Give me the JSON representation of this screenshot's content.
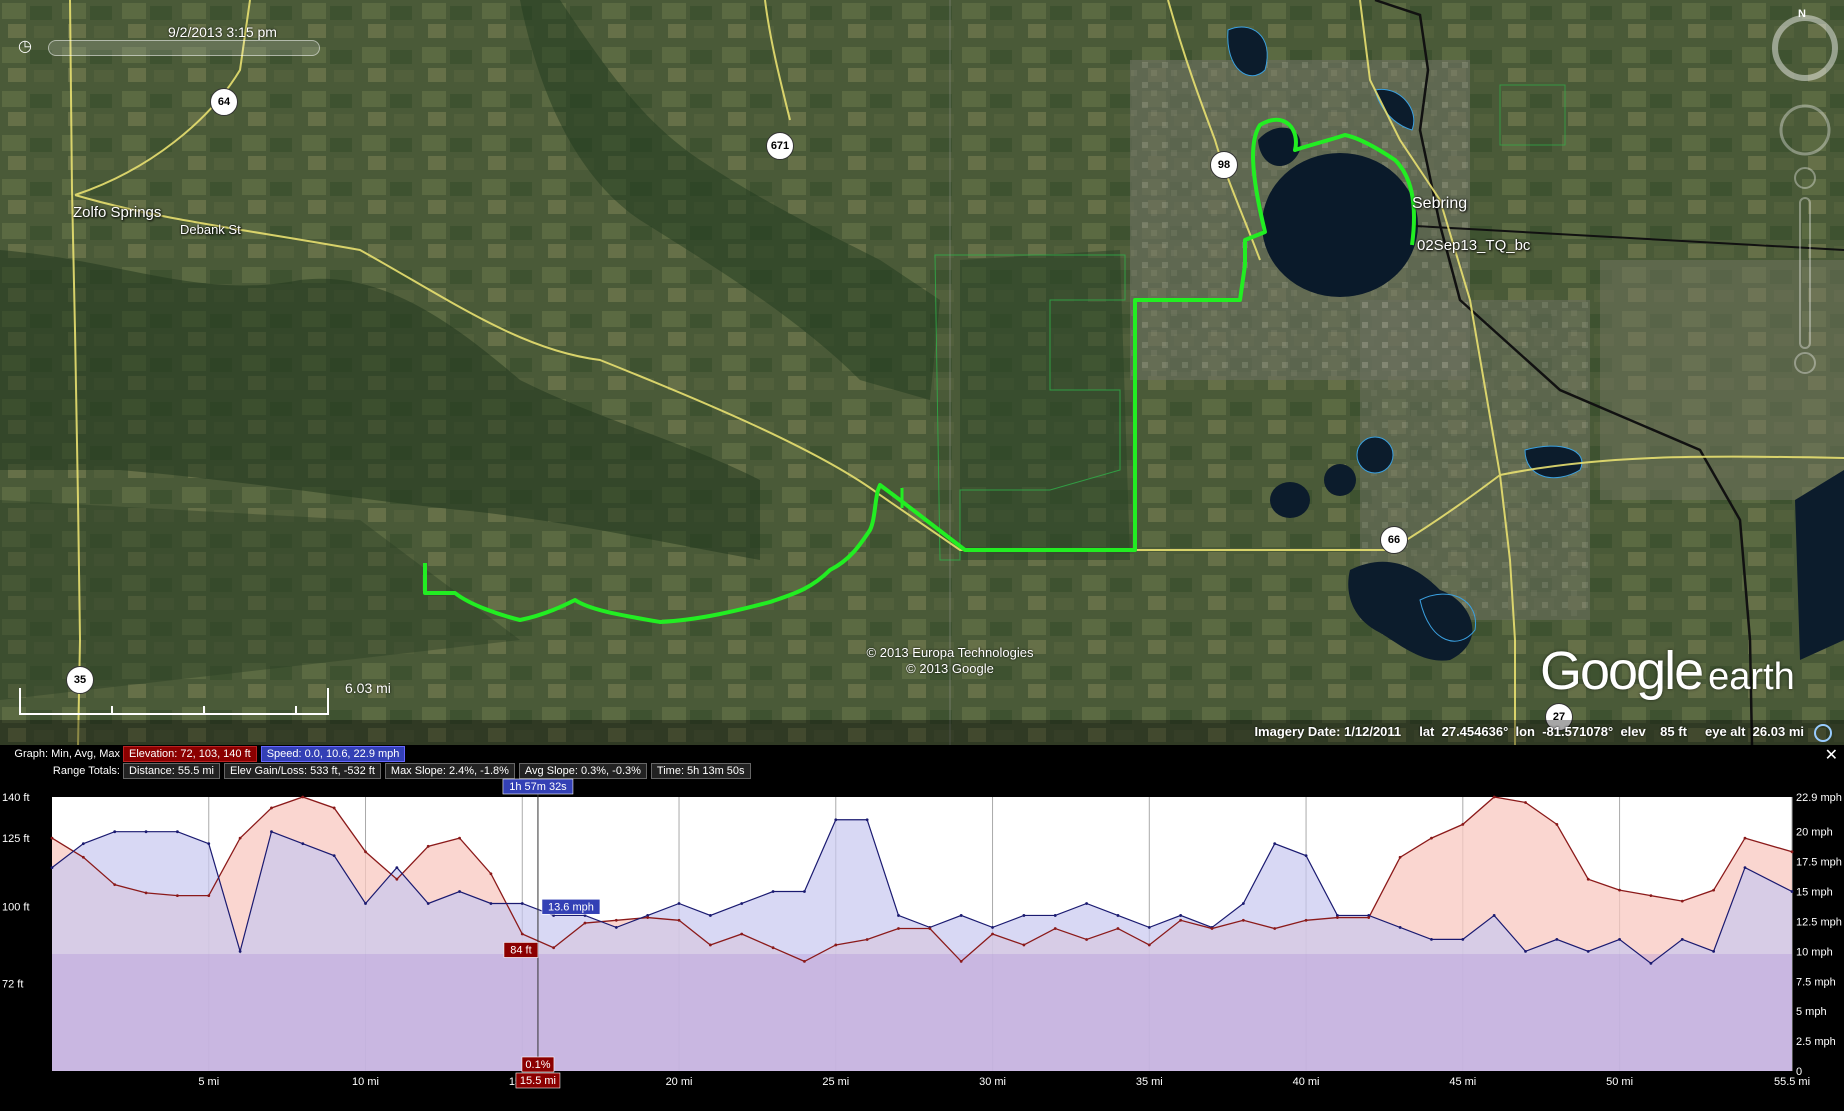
{
  "map": {
    "time_label": "9/2/2013   3:15 pm",
    "places": [
      {
        "name": "Zolfo Springs"
      },
      {
        "name": "Debank St"
      },
      {
        "name": "Sebring"
      },
      {
        "name": "02Sep13_TQ_bc"
      }
    ],
    "routes": [
      "64",
      "671",
      "98",
      "35",
      "66",
      "27"
    ],
    "scale_label": "6.03 mi",
    "copyright": [
      "© 2013 Europa Technologies",
      "© 2013 Google"
    ],
    "logo": {
      "main": "Google",
      "sub": "earth"
    },
    "compass_letter": "N",
    "status": {
      "imagery_date": "Imagery Date: 1/12/2011",
      "lat": "lat  27.454636°",
      "lon": "lon  -81.571078°",
      "elev": "elev    85 ft",
      "eye_alt": "eye alt  26.03 mi"
    },
    "colors": {
      "track": "#22ee22",
      "road": "#e8e070",
      "water": "#0a1a2a"
    }
  },
  "profile": {
    "graph_caption": "Graph: Min, Avg, Max",
    "elevation_box": "Elevation: 72, 103, 140 ft",
    "speed_box": "Speed: 0.0, 10.6, 22.9 mph",
    "range_caption": "Range Totals:",
    "distance_box": "Distance: 55.5 mi",
    "gain_box": "Elev Gain/Loss: 533 ft, -532 ft",
    "max_slope_box": "Max Slope: 2.4%, -1.8%",
    "avg_slope_box": "Avg Slope: 0.3%, -0.3%",
    "time_box": "Time: 5h 13m 50s",
    "cursor_time": "1h 57m 32s",
    "cursor_speed": "13.6 mph",
    "cursor_elev": "84 ft",
    "cursor_slope": "0.1%",
    "cursor_dist": "15.5 mi",
    "colors": {
      "elevation": "#8b1a1a",
      "speed": "#1a1a70",
      "elev_fill": "#f8c8c0",
      "speed_fill": "#c8c8f0"
    }
  },
  "chart_data": {
    "type": "line",
    "x_unit": "mi",
    "xlim": [
      0,
      55.5
    ],
    "x_ticks": [
      "5 mi",
      "10 mi",
      "15 mi",
      "20 mi",
      "25 mi",
      "30 mi",
      "35 mi",
      "40 mi",
      "45 mi",
      "50 mi",
      "55.5 mi"
    ],
    "y_left_ticks": [
      "140 ft",
      "125 ft",
      "100 ft",
      "72 ft"
    ],
    "y_left_lim": [
      40,
      140
    ],
    "y_right_ticks": [
      "22.9 mph",
      "20 mph",
      "17.5 mph",
      "15 mph",
      "12.5 mph",
      "10 mph",
      "7.5 mph",
      "5 mph",
      "2.5 mph",
      "0"
    ],
    "y_right_lim": [
      0,
      22.9
    ],
    "series": [
      {
        "name": "Elevation",
        "x": [
          0,
          1,
          2,
          3,
          4,
          5,
          6,
          7,
          8,
          9,
          10,
          11,
          12,
          13,
          14,
          15,
          16,
          17,
          18,
          19,
          20,
          21,
          22,
          23,
          24,
          25,
          26,
          27,
          28,
          29,
          30,
          31,
          32,
          33,
          34,
          35,
          36,
          37,
          38,
          39,
          40,
          41,
          42,
          43,
          44,
          45,
          46,
          47,
          48,
          49,
          50,
          51,
          52,
          53,
          54,
          55.5
        ],
        "values": [
          125,
          118,
          108,
          105,
          104,
          104,
          125,
          136,
          140,
          136,
          120,
          110,
          122,
          125,
          112,
          90,
          85,
          94,
          95,
          96,
          95,
          86,
          90,
          85,
          80,
          86,
          88,
          92,
          92,
          80,
          90,
          86,
          92,
          88,
          92,
          86,
          95,
          92,
          95,
          92,
          95,
          96,
          96,
          118,
          125,
          130,
          140,
          138,
          130,
          110,
          106,
          104,
          102,
          106,
          125,
          120
        ]
      },
      {
        "name": "Speed",
        "x": [
          0,
          1,
          2,
          3,
          4,
          5,
          6,
          7,
          8,
          9,
          10,
          11,
          12,
          13,
          14,
          15,
          16,
          17,
          18,
          19,
          20,
          21,
          22,
          23,
          24,
          25,
          26,
          27,
          28,
          29,
          30,
          31,
          32,
          33,
          34,
          35,
          36,
          37,
          38,
          39,
          40,
          41,
          42,
          43,
          44,
          45,
          46,
          47,
          48,
          49,
          50,
          51,
          52,
          53,
          54,
          55.5
        ],
        "values": [
          17,
          19,
          20,
          20,
          20,
          19,
          10,
          20,
          19,
          18,
          14,
          17,
          14,
          15,
          14,
          14,
          13,
          13,
          12,
          13,
          14,
          13,
          14,
          15,
          15,
          21,
          21,
          13,
          12,
          13,
          12,
          13,
          13,
          14,
          13,
          12,
          13,
          12,
          14,
          19,
          18,
          13,
          13,
          12,
          11,
          11,
          13,
          10,
          11,
          10,
          11,
          9,
          11,
          10,
          17,
          15
        ]
      }
    ]
  }
}
